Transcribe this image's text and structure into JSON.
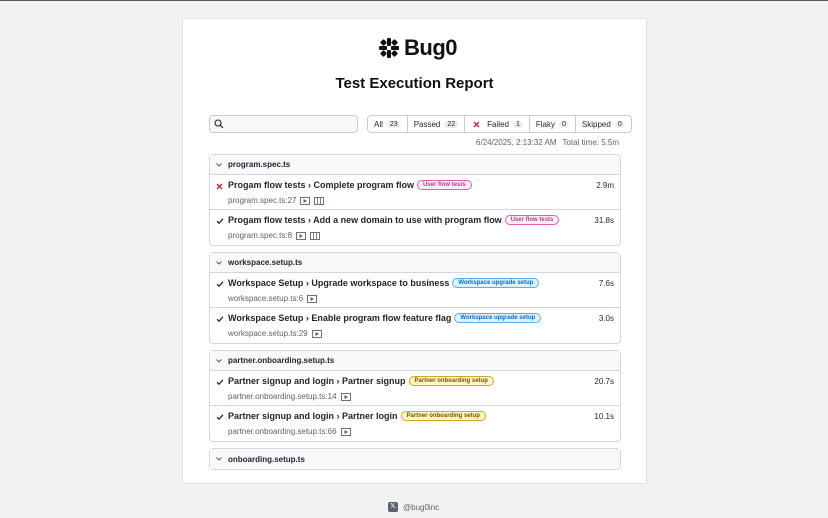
{
  "logo": {
    "text": "Bug0"
  },
  "report_title": "Test Execution Report",
  "search": {
    "placeholder": ""
  },
  "filters": [
    {
      "label": "All",
      "count": "23"
    },
    {
      "label": "Passed",
      "count": "22"
    },
    {
      "label": "Failed",
      "count": "1"
    },
    {
      "label": "Flaky",
      "count": "0"
    },
    {
      "label": "Skipped",
      "count": "0"
    }
  ],
  "meta": {
    "datetime": "6/24/2025, 2:13:32 AM",
    "total_time": "Total time: 5.5m"
  },
  "files": [
    {
      "name": "program.spec.ts",
      "tests": [
        {
          "status": "failed",
          "title": "Progam flow tests › Complete program flow",
          "tag": "User flow tests",
          "duration": "2.9m",
          "location": "program.spec.ts:27"
        },
        {
          "status": "passed",
          "title": "Progam flow tests › Add a new domain to use with program flow",
          "tag": "User flow tests",
          "duration": "31.8s",
          "location": "program.spec.ts:8"
        }
      ]
    },
    {
      "name": "workspace.setup.ts",
      "tests": [
        {
          "status": "passed",
          "title": "Workspace Setup › Upgrade workspace to business",
          "tag": "Workspace upgrade setup",
          "duration": "7.6s",
          "location": "workspace.setup.ts:6"
        },
        {
          "status": "passed",
          "title": "Workspace Setup › Enable program flow feature flag",
          "tag": "Workspace upgrade setup",
          "duration": "3.0s",
          "location": "workspace.setup.ts:29"
        }
      ]
    },
    {
      "name": "partner.onboarding.setup.ts",
      "tests": [
        {
          "status": "passed",
          "title": "Partner signup and login › Partner signup",
          "tag": "Partner onboarding setup",
          "duration": "20.7s",
          "location": "partner.onboarding.setup.ts:14"
        },
        {
          "status": "passed",
          "title": "Partner signup and login › Partner login",
          "tag": "Partner onboarding setup",
          "duration": "10.1s",
          "location": "partner.onboarding.setup.ts:66"
        }
      ]
    },
    {
      "name": "onboarding.setup.ts",
      "tests": []
    }
  ],
  "footer": {
    "handle": "@bug0inc"
  }
}
